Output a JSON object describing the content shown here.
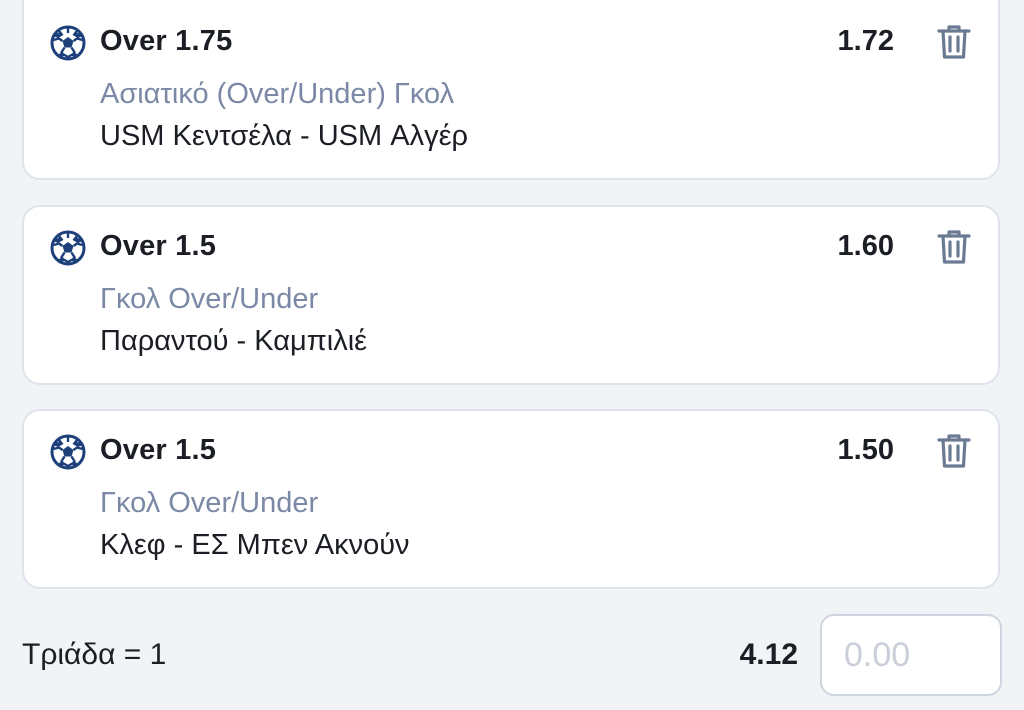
{
  "bets": [
    {
      "selection": "Over 1.75",
      "odds": "1.72",
      "market": "Ασιατικό (Over/Under) Γκολ",
      "match": "USM Κεντσέλα - USM Αλγέρ",
      "icon": "soccer-ball-icon"
    },
    {
      "selection": "Over 1.5",
      "odds": "1.60",
      "market": "Γκολ Over/Under",
      "match": "Παραντού - Καμπιλιέ",
      "icon": "soccer-ball-icon"
    },
    {
      "selection": "Over 1.5",
      "odds": "1.50",
      "market": "Γκολ Over/Under",
      "match": "Κλεφ - ΕΣ Μπεν Ακνούν",
      "icon": "soccer-ball-icon"
    }
  ],
  "footer": {
    "combo_label": "Τριάδα = 1",
    "total_odds": "4.12",
    "stake_placeholder": "0.00"
  },
  "colors": {
    "ball": "#1d3f7a",
    "market_text": "#7c89a6",
    "trash": "#6b7a93",
    "card_border": "#dfe3ea",
    "background": "#f1f3f6"
  }
}
